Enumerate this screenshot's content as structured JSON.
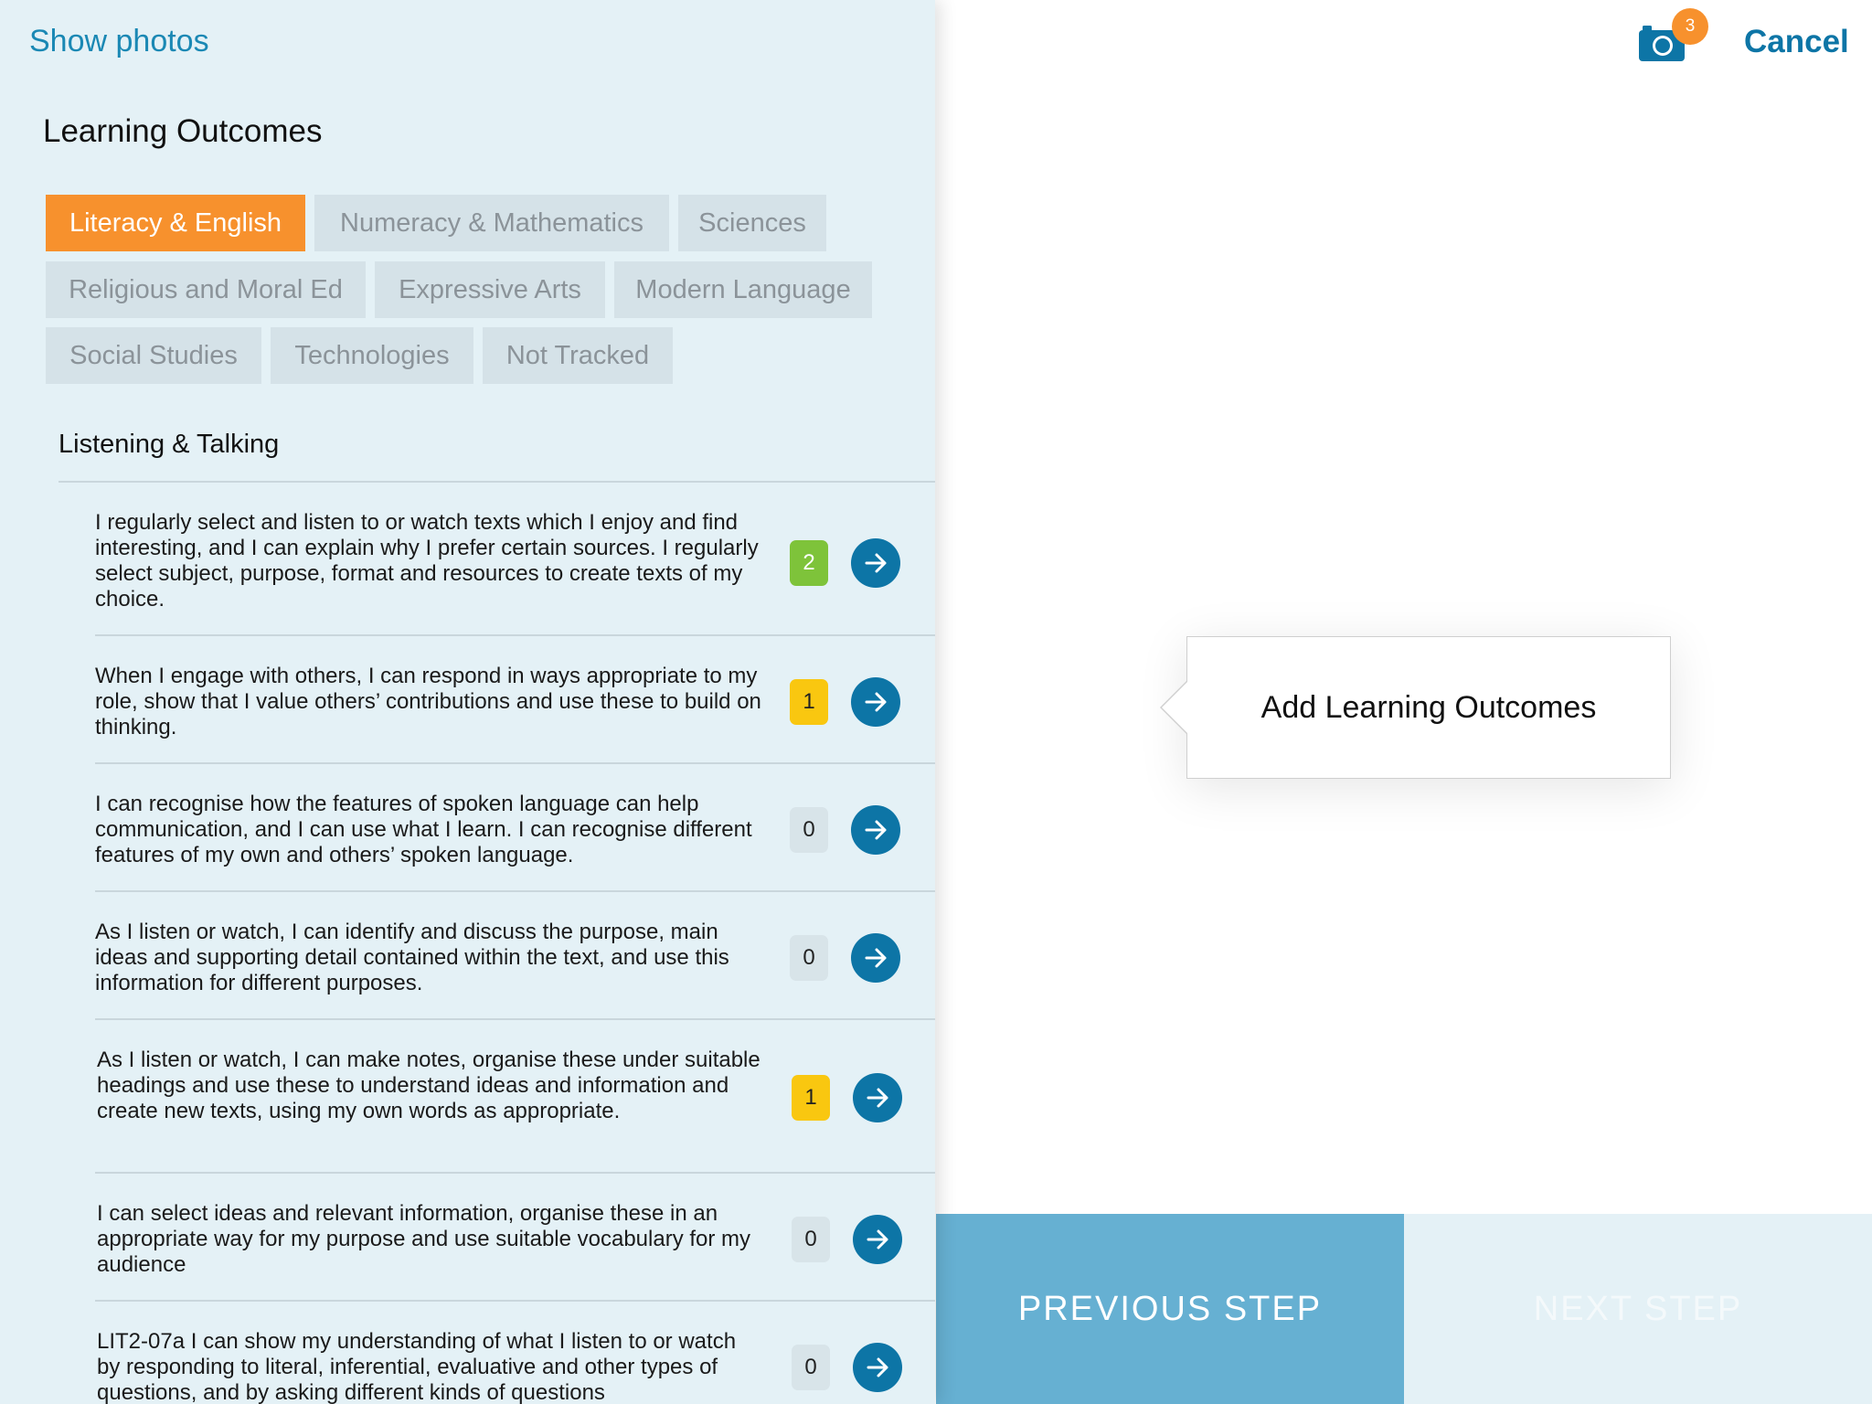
{
  "header": {
    "show_photos": "Show photos",
    "cancel": "Cancel",
    "camera_count": "3",
    "camera_icon": "camera-icon"
  },
  "panel": {
    "title": "Learning Outcomes",
    "subheading": "Listening & Talking"
  },
  "tabs": [
    {
      "label": "Literacy & English",
      "active": true
    },
    {
      "label": "Numeracy & Mathematics",
      "active": false
    },
    {
      "label": "Sciences",
      "active": false
    },
    {
      "label": "Religious and Moral Ed",
      "active": false
    },
    {
      "label": "Expressive Arts",
      "active": false
    },
    {
      "label": "Modern Language",
      "active": false
    },
    {
      "label": "Social Studies",
      "active": false
    },
    {
      "label": "Technologies",
      "active": false
    },
    {
      "label": "Not Tracked",
      "active": false
    }
  ],
  "outcomes": [
    {
      "text": "I regularly select and listen to or watch texts which I enjoy and find interesting, and I can explain why I prefer certain sources. I regularly select subject, purpose, format and resources to create texts of my choice.",
      "count": "2",
      "status": "green"
    },
    {
      "text": "When I engage with others, I can respond in ways appropriate to my role, show that I value others’ contributions and use these to build on thinking.",
      "count": "1",
      "status": "yellow"
    },
    {
      "text": "I can recognise how the features of spoken language can help communication, and I can use what I learn. I can recognise different features of my own and others’ spoken language.",
      "count": "0",
      "status": "none"
    },
    {
      "text": "As I listen or watch, I can identify and discuss the purpose, main ideas and supporting detail contained within the text, and use this information for different purposes.",
      "count": "0",
      "status": "none"
    },
    {
      "text": "As I listen or watch, I can make notes, organise these under suitable headings and use these to understand ideas and information and create new texts, using my own words as appropriate.",
      "count": "1",
      "status": "yellow"
    },
    {
      "text": "I can select ideas and relevant information, organise these in an appropriate way for my purpose and use suitable vocabulary for my audience",
      "count": "0",
      "status": "none"
    },
    {
      "text": "LIT2-07a I can show my understanding of what I listen to or watch by responding to literal, inferential, evaluative and other types of questions, and by asking different kinds of questions",
      "count": "0",
      "status": "none"
    }
  ],
  "tooltip": {
    "text": "Add Learning Outcomes"
  },
  "footer": {
    "previous": "PREVIOUS STEP",
    "next": "NEXT STEP"
  },
  "colors": {
    "accent_orange": "#f7912d",
    "primary_blue": "#0d75a6",
    "badge_green": "#7ec33a",
    "badge_yellow": "#f9c710",
    "panel_bg": "#e4f1f6"
  }
}
